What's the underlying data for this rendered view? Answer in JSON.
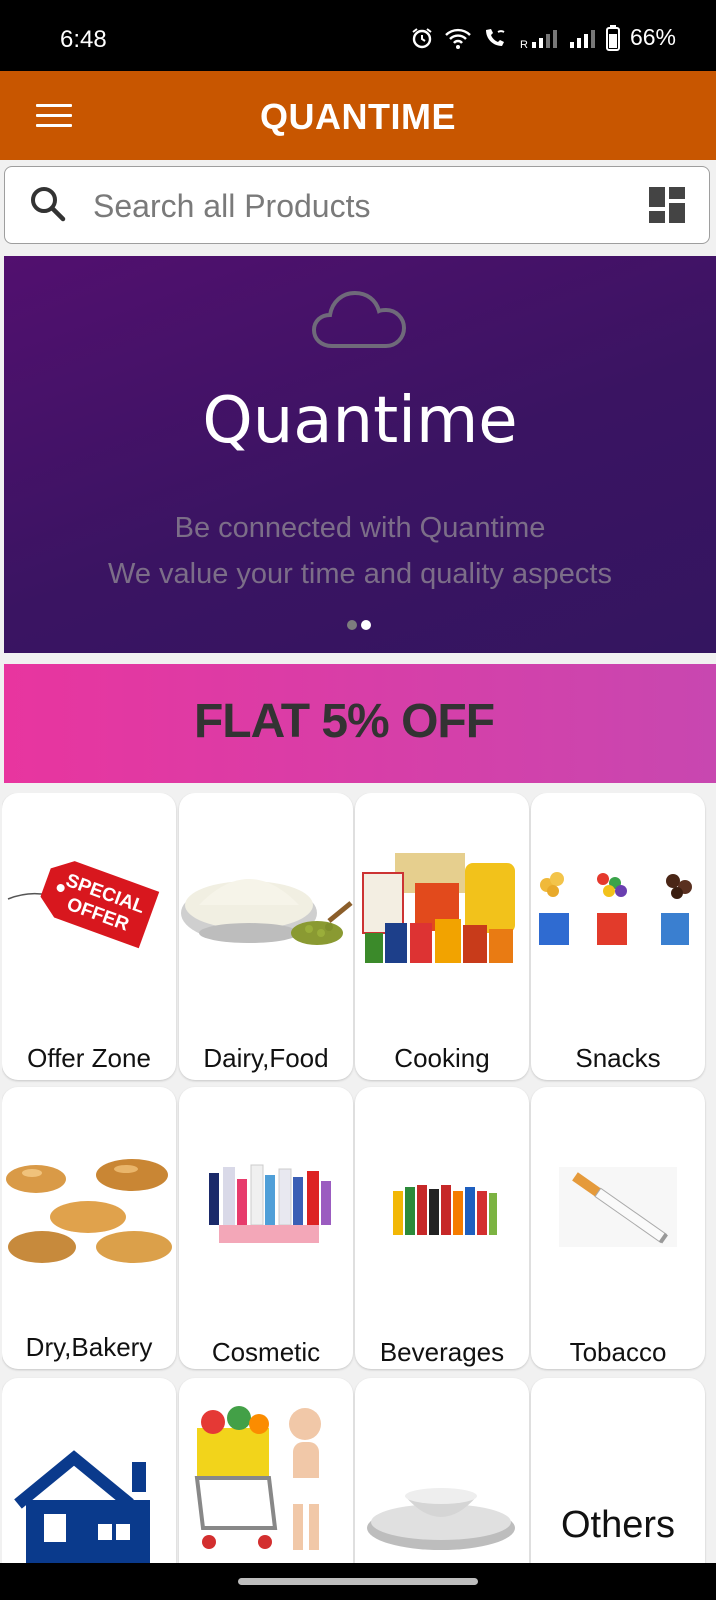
{
  "status_bar": {
    "time": "6:48",
    "battery": "66%"
  },
  "app_bar": {
    "title": "QUANTIME",
    "menu_icon": "hamburger-icon"
  },
  "search": {
    "placeholder": "Search all Products",
    "icon": "search-icon",
    "view_toggle_icon": "grid-view-icon"
  },
  "banner": {
    "title": "Quantime",
    "line1": "Be connected with Quantime",
    "line2": "We value your time and quality aspects",
    "slide_count": 2,
    "active_slide": 2
  },
  "offer": {
    "text": "FLAT 5% OFF"
  },
  "categories": [
    {
      "label": "Offer Zone",
      "icon": "special-offer-tag-image"
    },
    {
      "label": "Dairy,Food",
      "icon": "flour-bowl-image"
    },
    {
      "label": "Cooking",
      "icon": "cooking-products-image"
    },
    {
      "label": "Snacks",
      "icon": "snacks-image"
    },
    {
      "label": "Dry,Bakery",
      "icon": "bakery-bread-image"
    },
    {
      "label": "Cosmetic",
      "icon": "cosmetics-bottles-image"
    },
    {
      "label": "Beverages",
      "icon": "beverage-bottles-image"
    },
    {
      "label": "Tobacco",
      "icon": "cigarette-image"
    },
    {
      "label": "",
      "icon": "house-image"
    },
    {
      "label": "",
      "icon": "baby-shopping-cart-image"
    },
    {
      "label": "",
      "icon": "plates-bowls-image"
    },
    {
      "label": "Others",
      "icon": ""
    }
  ],
  "colors": {
    "app_bar": "#c85600",
    "banner": "#3b1465",
    "offer_start": "#e8359f",
    "offer_end": "#c847b0"
  }
}
